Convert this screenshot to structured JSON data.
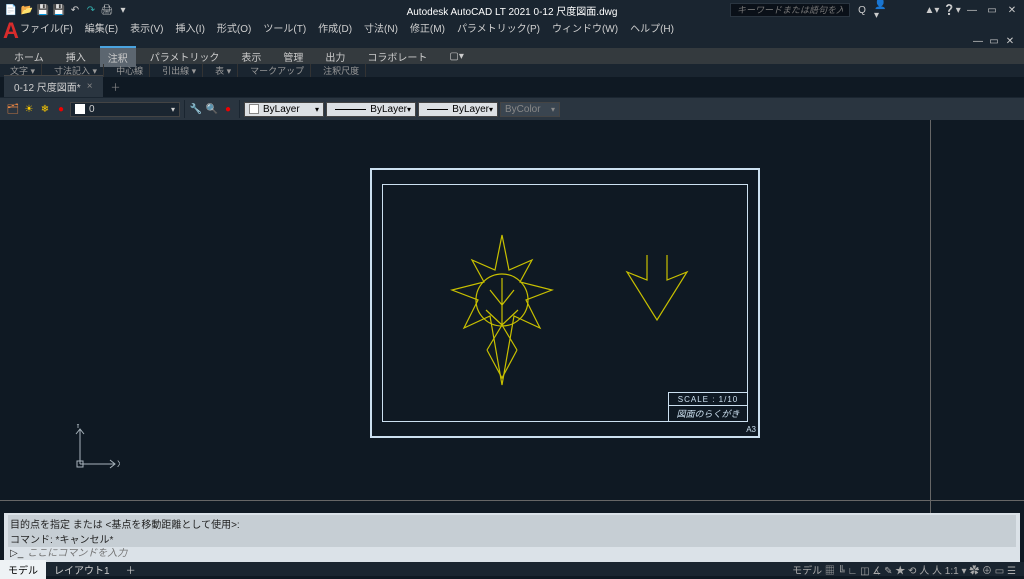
{
  "title": "Autodesk AutoCAD LT 2021   0-12 尺度図面.dwg",
  "search_placeholder": "キーワードまたは語句を入力",
  "menu": [
    "ファイル(F)",
    "編集(E)",
    "表示(V)",
    "挿入(I)",
    "形式(O)",
    "ツール(T)",
    "作成(D)",
    "寸法(N)",
    "修正(M)",
    "パラメトリック(P)",
    "ウィンドウ(W)",
    "ヘルプ(H)"
  ],
  "ribbon_tabs": [
    "ホーム",
    "挿入",
    "注釈",
    "パラメトリック",
    "表示",
    "管理",
    "出力",
    "コラボレート"
  ],
  "ribbon_active": 2,
  "ribbon_panels": [
    "文字 ▾",
    "寸法記入 ▾",
    "中心線",
    "引出線 ▾",
    "表 ▾",
    "マークアップ",
    "注釈尺度"
  ],
  "doc_tab": "0-12 尺度図面*",
  "layer_current": "0",
  "prop_color": "ByLayer",
  "prop_lt": "ByLayer",
  "prop_lw": "ByLayer",
  "prop_plot": "ByColor",
  "titleblock_scale": "SCALE : 1/10",
  "titleblock_title": "図面のらくがき",
  "sheet_size": "A3",
  "cmd_hist1": "目的点を指定 または <基点を移動距離として使用>:",
  "cmd_hist2": "コマンド: *キャンセル*",
  "cmd_placeholder": "ここにコマンドを入力",
  "status_tabs": [
    "モデル",
    "レイアウト1"
  ],
  "status_icons": "モデル   ▦   ╚   ∟   ◫   ∡   ✎   ★   ⟲   人   人   1:1 ▾   ✿   ⊕   ▭   ☰"
}
